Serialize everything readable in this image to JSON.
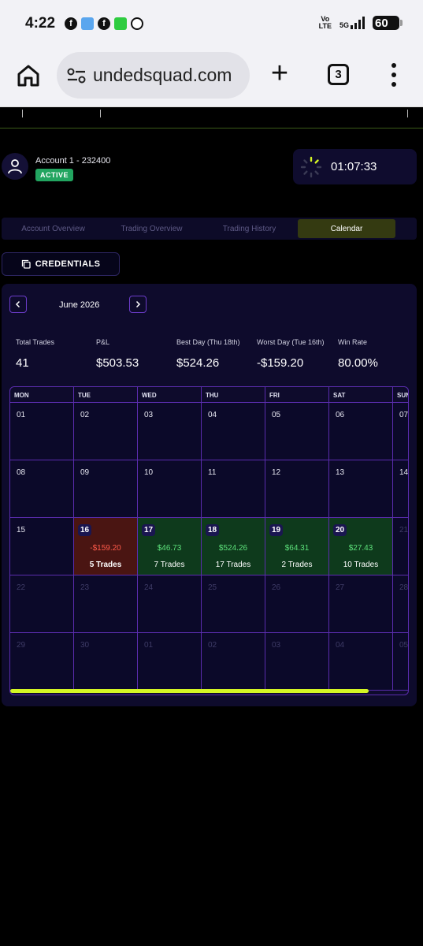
{
  "statusbar": {
    "time": "4:22",
    "network": "5G",
    "volte_top": "Vo",
    "volte_bottom": "LTE",
    "battery": "60"
  },
  "browser": {
    "url": "undedsquad.com",
    "tab_count": "3"
  },
  "account": {
    "name": "Account 1 - 232400",
    "status": "ACTIVE"
  },
  "timer": {
    "value": "01:07:33"
  },
  "tabs": [
    {
      "label": "Account Overview",
      "active": false
    },
    {
      "label": "Trading Overview",
      "active": false
    },
    {
      "label": "Trading History",
      "active": false
    },
    {
      "label": "Calendar",
      "active": true
    }
  ],
  "credentials_button": "CREDENTIALS",
  "calendar": {
    "month": "June 2026",
    "stats": [
      {
        "label": "Total Trades",
        "value": "41"
      },
      {
        "label": "P&L",
        "value": "$503.53"
      },
      {
        "label": "Best Day (Thu 18th)",
        "value": "$524.26"
      },
      {
        "label": "Worst Day (Tue 16th)",
        "value": "-$159.20"
      },
      {
        "label": "Win Rate",
        "value": "80.00%"
      }
    ],
    "weekdays": [
      "MON",
      "TUE",
      "WED",
      "THU",
      "FRI",
      "SAT",
      "SUN"
    ],
    "weeks": [
      [
        {
          "day": "01"
        },
        {
          "day": "02"
        },
        {
          "day": "03"
        },
        {
          "day": "04"
        },
        {
          "day": "05"
        },
        {
          "day": "06"
        },
        {
          "day": "07"
        }
      ],
      [
        {
          "day": "08"
        },
        {
          "day": "09"
        },
        {
          "day": "10"
        },
        {
          "day": "11"
        },
        {
          "day": "12"
        },
        {
          "day": "13"
        },
        {
          "day": "14"
        }
      ],
      [
        {
          "day": "15"
        },
        {
          "day": "16",
          "pnl": "-$159.20",
          "trades": "5 Trades",
          "kind": "loss"
        },
        {
          "day": "17",
          "pnl": "$46.73",
          "trades": "7 Trades",
          "kind": "gain"
        },
        {
          "day": "18",
          "pnl": "$524.26",
          "trades": "17 Trades",
          "kind": "gain"
        },
        {
          "day": "19",
          "pnl": "$64.31",
          "trades": "2 Trades",
          "kind": "gain"
        },
        {
          "day": "20",
          "pnl": "$27.43",
          "trades": "10 Trades",
          "kind": "gain"
        },
        {
          "day": "21",
          "kind": "other"
        }
      ],
      [
        {
          "day": "22",
          "kind": "other"
        },
        {
          "day": "23",
          "kind": "other"
        },
        {
          "day": "24",
          "kind": "other"
        },
        {
          "day": "25",
          "kind": "other"
        },
        {
          "day": "26",
          "kind": "other"
        },
        {
          "day": "27",
          "kind": "other"
        },
        {
          "day": "28",
          "kind": "other"
        }
      ],
      [
        {
          "day": "29",
          "kind": "other"
        },
        {
          "day": "30",
          "kind": "other"
        },
        {
          "day": "01",
          "kind": "other"
        },
        {
          "day": "02",
          "kind": "other"
        },
        {
          "day": "03",
          "kind": "other"
        },
        {
          "day": "04",
          "kind": "other"
        },
        {
          "day": "05",
          "kind": "other"
        }
      ]
    ]
  },
  "colors": {
    "accent": "#d4f524",
    "loss": "#ff5a4a",
    "gain": "#5ce07a",
    "card": "#0e0b2c",
    "grid_border": "#5a2cad"
  }
}
